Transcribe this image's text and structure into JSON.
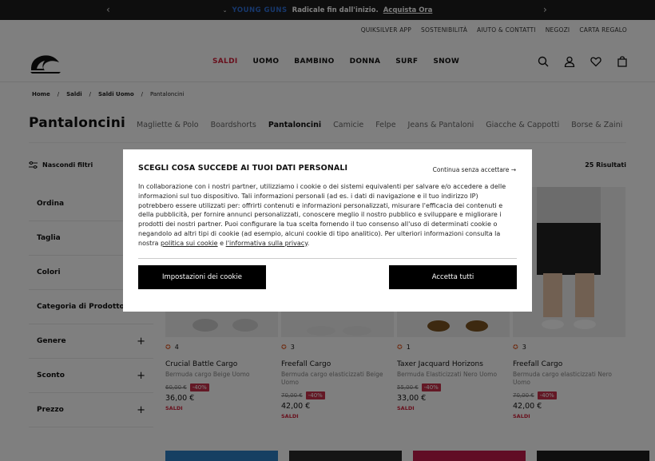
{
  "promo": {
    "prev_icon": "chevron-left-icon",
    "brand": "YOUNG GUNS",
    "text": "Radicale fin dall'inizio.",
    "cta": "Acquista Ora",
    "next_icon": "chevron-right-icon"
  },
  "utility_links": [
    "QUIKSILVER APP",
    "SOSTENIBILITÀ",
    "AIUTO & CONTATTI",
    "NEGOZI",
    "CARTA REGALO"
  ],
  "main_nav": [
    "SALDI",
    "UOMO",
    "BAMBINO",
    "DONNA",
    "SURF",
    "SNOW"
  ],
  "colors": {
    "sale": "#d0213a",
    "brand_blue": "#2f6fd6",
    "discount_bg": "#c8304a"
  },
  "breadcrumb": [
    "Home",
    "Saldi",
    "Saldi Uomo",
    "Pantaloncini"
  ],
  "page_title": "Pantaloncini",
  "categories": [
    "Magliette & Polo",
    "Boardshorts",
    "Pantaloncini",
    "Camicie",
    "Felpe",
    "Jeans & Pantaloni",
    "Giacche & Cappotti",
    "Borse & Zaini"
  ],
  "hide_filters": "Nascondi filtri",
  "results": "25 Risultati",
  "filters": [
    "Ordina",
    "Taglia",
    "Colori",
    "Categoria di Prodotto",
    "Genere",
    "Sconto",
    "Prezzo"
  ],
  "products": [
    {
      "rating": "4",
      "name": "Crucial Battle Cargo",
      "desc": "Bermuda cargo Beige Uomo",
      "old": "60,00 €",
      "disc": "-40%",
      "price": "36,00 €",
      "tag": "SALDI"
    },
    {
      "rating": "3",
      "name": "Freefall Cargo",
      "desc": "Bermuda cargo elasticizzati Beige Uomo",
      "old": "70,00 €",
      "disc": "-40%",
      "price": "42,00 €",
      "tag": "SALDI"
    },
    {
      "rating": "1",
      "name": "Taxer Jacquard Horizons",
      "desc": "Bermuda Elasticizzati Nero Uomo",
      "old": "55,00 €",
      "disc": "-40%",
      "price": "33,00 €",
      "tag": "SALDI"
    },
    {
      "rating": "3",
      "name": "Freefall Cargo",
      "desc": "Bermuda cargo elasticizzati Nero Uomo",
      "old": "70,00 €",
      "disc": "-40%",
      "price": "42,00 €",
      "tag": "SALDI"
    }
  ],
  "modal": {
    "title": "SCEGLI COSA SUCCEDE AI TUOI DATI PERSONALI",
    "skip": "Continua senza accettare →",
    "body": "In collaborazione con i nostri partner, utilizziamo i cookie o dei sistemi equivalenti per salvare e/o accedere a delle informazioni sul tuo dispositivo. Tali informazioni personali (ad es. i dati di navigazione e il tuo indirizzo IP) potrebbero essere utilizzati per: offrirti contenuti e informazioni personalizzati, misurare l'efficacia dei contenuti e della pubblicità, per fornire annunci personalizzati, conoscere meglio il nostro pubblico e sviluppare e migliorare i prodotti dei nostri partner. Puoi configurare la tua scelta fornendo il tuo consenso all'uso di determinati cookie o negandolo ad altri tipi di cookie (ad esempio, alcuni cookie di tipo analitico). Per ulteriori informazioni consulta la nostra ",
    "cookie_link": "politica sui cookie",
    "and": " e ",
    "privacy_link": "l'informativa sulla privacy",
    "end": ".",
    "settings_btn": "Impostazioni dei cookie",
    "accept_btn": "Accetta tutti"
  }
}
